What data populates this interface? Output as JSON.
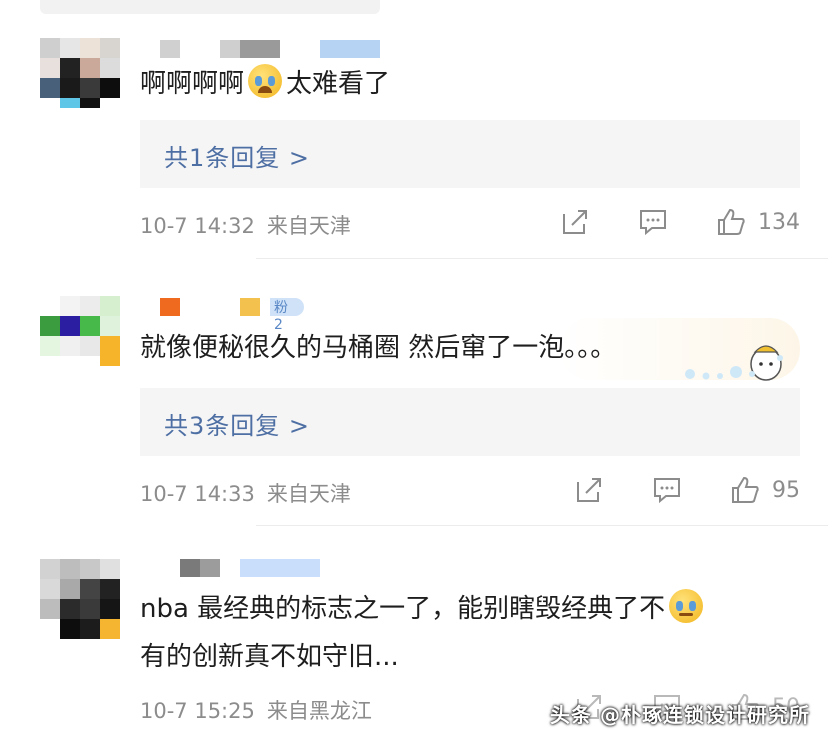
{
  "comments": [
    {
      "text_before": "啊啊啊啊",
      "text_after": "太难看了",
      "emoji_icon": "crying-face-icon",
      "reply_label": "共1条回复 >",
      "date": "10-7 14:32",
      "location": "来自天津",
      "likes": "134"
    },
    {
      "badge": "粉2",
      "text": "就像便秘很久的马桶圈 然后窜了一泡。。。",
      "reply_label": "共3条回复 >",
      "date": "10-7 14:33",
      "location": "来自天津",
      "likes": "95"
    },
    {
      "text_line1": "nba 最经典的标志之一了，能别瞎毁经典了不",
      "text_line2": "有的创新真不如守旧...",
      "emoji_icon": "shrug-face-icon",
      "date": "10-7 15:25",
      "location": "来自黑龙江",
      "likes": "50"
    }
  ],
  "watermark": "头条 @朴琢连锁设计研究所",
  "icons": {
    "share": "share-icon",
    "comment": "comment-icon",
    "like": "thumbs-up-icon"
  },
  "colors": {
    "reply_link": "#4e6fa3",
    "meta_gray": "#8c8c8c",
    "reply_bg": "#f5f5f6"
  }
}
